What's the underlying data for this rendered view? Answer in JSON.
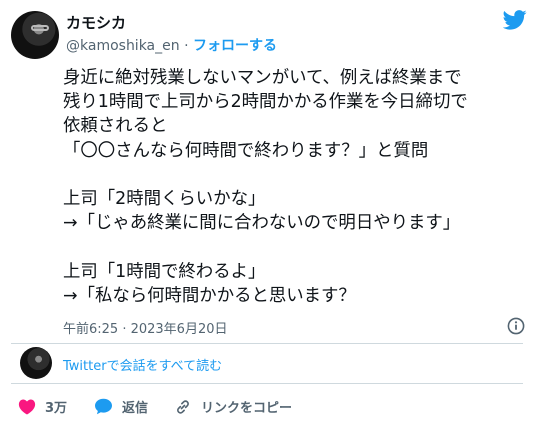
{
  "author": {
    "name": "カモシカ",
    "handle": "@kamoshika_en",
    "separator": "·",
    "follow_label": "フォローする"
  },
  "tweet": {
    "lines": [
      "身近に絶対残業しないマンがいて、例えば終業まで",
      "残り1時間で上司から2時間かかる作業を今日締切で",
      "依頼されると",
      "「〇〇さんなら何時間で終わります？」と質問",
      "",
      "上司「2時間くらいかな」",
      "→「じゃあ終業に間に合わないので明日やります」",
      "",
      "上司「1時間で終わるよ」",
      "→「私なら何時間かかると思います？"
    ],
    "timestamp": "午前6:25 · 2023年6月20日"
  },
  "conversation": {
    "link_label": "Twitterで会話をすべて読む"
  },
  "actions": {
    "like_count": "3万",
    "reply_label": "返信",
    "copy_link_label": "リンクをコピー"
  },
  "colors": {
    "accent": "#1d9bf0",
    "like": "#f91880",
    "muted": "#536471",
    "text": "#0f1419"
  },
  "icons": [
    "twitter-bird-icon",
    "info-icon",
    "heart-icon",
    "reply-bubble-icon",
    "link-icon"
  ]
}
